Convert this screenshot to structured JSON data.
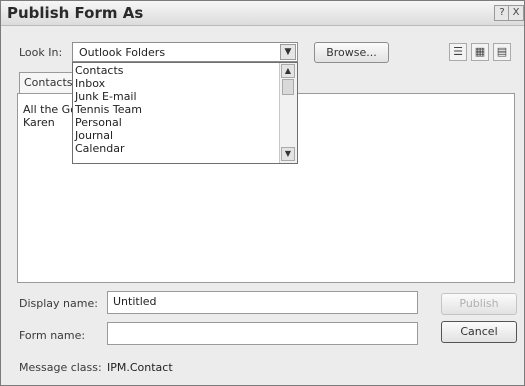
{
  "window": {
    "title": "Publish Form As"
  },
  "titlebar_buttons": {
    "help": "?",
    "close": "X"
  },
  "look_in": {
    "label": "Look In:",
    "value": "Outlook Folders"
  },
  "browse_label": "Browse...",
  "tab_label": "Contacts",
  "list_items": [
    "All the Go",
    "Karen"
  ],
  "dropdown_items": [
    "Contacts",
    "Inbox",
    "Junk E-mail",
    "Tennis Team",
    "Personal",
    "Journal",
    "Calendar"
  ],
  "display_name": {
    "label": "Display name:",
    "value": "Untitled"
  },
  "form_name": {
    "label": "Form name:",
    "value": ""
  },
  "publish_label": "Publish",
  "cancel_label": "Cancel",
  "message_class": {
    "label": "Message class:",
    "value": "IPM.Contact"
  }
}
